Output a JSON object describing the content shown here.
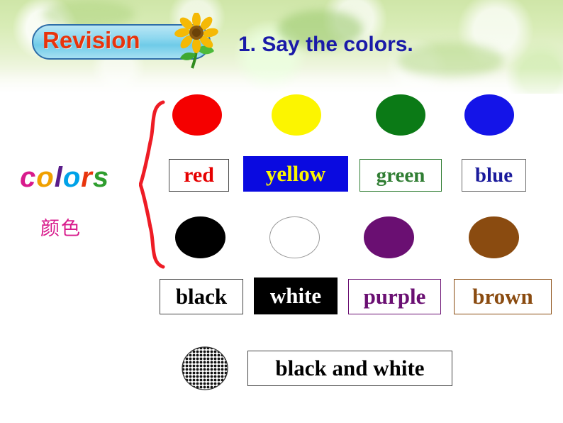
{
  "slide": {
    "banner_label": "Revision",
    "title": "1. Say the colors.",
    "left_label_word": "colors",
    "left_label_cn": "颜色",
    "icons": {
      "sunflower": "sunflower-icon",
      "brace": "curly-brace-icon"
    },
    "colors": {
      "banner_text": "#e8340c",
      "title_text": "#1a1aa8",
      "brace": "#ee1c25",
      "cn_label": "#d81b8c"
    }
  },
  "row1": {
    "dots": [
      {
        "name": "red-circle",
        "fill": "#f50000"
      },
      {
        "name": "yellow-circle",
        "fill": "#fcf500"
      },
      {
        "name": "green-circle",
        "fill": "#0b7a16"
      },
      {
        "name": "blue-circle",
        "fill": "#1414e8"
      }
    ],
    "words": [
      {
        "name": "word-red",
        "label": "red",
        "text_color": "#e60000",
        "bg": "#ffffff",
        "border": "#444444"
      },
      {
        "name": "word-yellow",
        "label": "yellow",
        "text_color": "#fcf500",
        "bg": "#0a0ae0",
        "border": "#0a0ae0"
      },
      {
        "name": "word-green",
        "label": "green",
        "text_color": "#2f7d32",
        "bg": "#ffffff",
        "border": "#2f7d32"
      },
      {
        "name": "word-blue",
        "label": "blue",
        "text_color": "#1a1a9c",
        "bg": "#ffffff",
        "border": "#6a6a6a"
      }
    ]
  },
  "row2": {
    "dots": [
      {
        "name": "black-circle",
        "fill": "#000000"
      },
      {
        "name": "white-circle",
        "fill": "#ffffff"
      },
      {
        "name": "purple-circle",
        "fill": "#6a0f72"
      },
      {
        "name": "brown-circle",
        "fill": "#8a4b10"
      }
    ],
    "words": [
      {
        "name": "word-black",
        "label": "black",
        "text_color": "#000000",
        "bg": "#ffffff",
        "border": "#444444"
      },
      {
        "name": "word-white",
        "label": "white",
        "text_color": "#ffffff",
        "bg": "#000000",
        "border": "#000000"
      },
      {
        "name": "word-purple",
        "label": "purple",
        "text_color": "#6a0f72",
        "bg": "#ffffff",
        "border": "#6a0f72"
      },
      {
        "name": "word-brown",
        "label": "brown",
        "text_color": "#8a4b10",
        "bg": "#ffffff",
        "border": "#8a4b10"
      }
    ]
  },
  "row3": {
    "dot": {
      "name": "black-and-white-circle",
      "fill": "checker"
    },
    "word": {
      "name": "word-black-and-white",
      "label": "black and white",
      "text_color": "#000000",
      "bg": "#ffffff",
      "border": "#444444"
    }
  }
}
